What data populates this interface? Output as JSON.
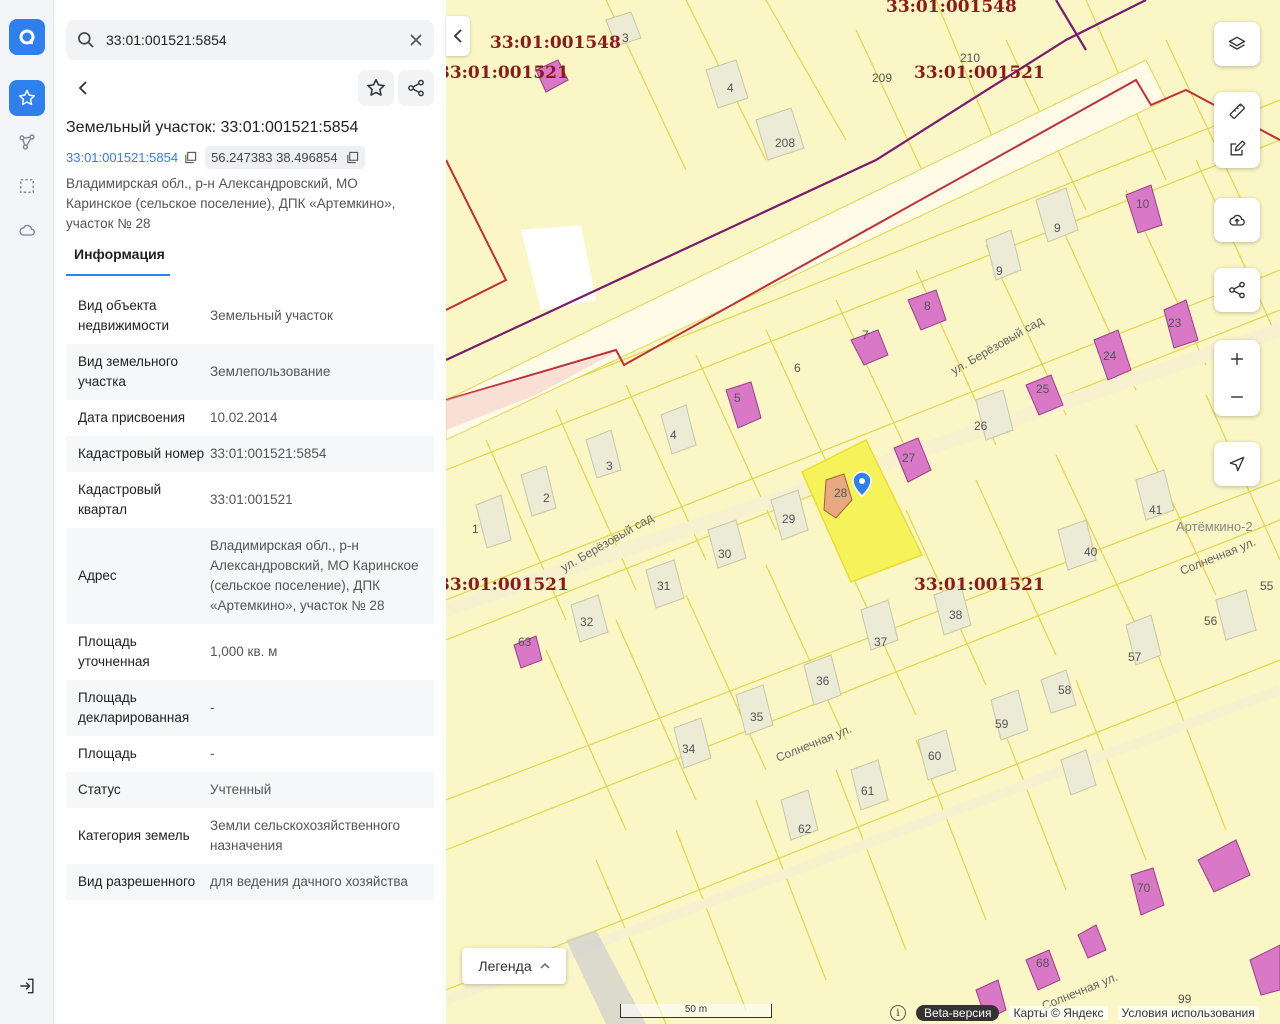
{
  "search": {
    "value": "33:01:001521:5854"
  },
  "object": {
    "title": "Земельный участок: 33:01:001521:5854",
    "cad_link": "33:01:001521:5854",
    "coords": "56.247383 38.496854",
    "address": "Владимирская обл., р-н Александровский, МО Каринское (сельское поселение), ДПК «Артемкино», участок № 28"
  },
  "tabs": {
    "info": "Информация"
  },
  "info_rows": [
    {
      "k": "Вид объекта недвижимости",
      "v": "Земельный участок"
    },
    {
      "k": "Вид земельного участка",
      "v": "Землепользование"
    },
    {
      "k": "Дата присвоения",
      "v": "10.02.2014"
    },
    {
      "k": "Кадастровый номер",
      "v": "33:01:001521:5854"
    },
    {
      "k": "Кадастровый квартал",
      "v": "33:01:001521"
    },
    {
      "k": "Адрес",
      "v": "Владимирская обл., р-н Александровский, МО Каринское (сельское поселение), ДПК «Артемкино», участок № 28"
    },
    {
      "k": "Площадь уточненная",
      "v": "1,000 кв. м"
    },
    {
      "k": "Площадь декларированная",
      "v": "-"
    },
    {
      "k": "Площадь",
      "v": "-"
    },
    {
      "k": "Статус",
      "v": "Учтенный"
    },
    {
      "k": "Категория земель",
      "v": "Земли сельскохозяйственного назначения"
    },
    {
      "k": "Вид разрешенного",
      "v": "для ведения дачного хозяйства"
    }
  ],
  "map": {
    "quarter_labels": [
      "33:01:001548",
      "33:01:001548",
      "33:01:001521",
      "33:01:001521",
      "33:01:001521",
      "33:01:001521"
    ],
    "streets": [
      "ул. Берёзовый сад",
      "ул. Берёзовый сад",
      "Солнечная ул.",
      "Солнечная ул.",
      "Солнечная ул."
    ],
    "place": "Артёмкино-2",
    "plot_numbers": [
      "3",
      "4",
      "209",
      "210",
      "208",
      "10",
      "9",
      "9",
      "8",
      "7",
      "6",
      "5",
      "23",
      "24",
      "25",
      "26",
      "27",
      "28",
      "4",
      "3",
      "2",
      "1",
      "29",
      "30",
      "31",
      "32",
      "63",
      "37",
      "36",
      "35",
      "34",
      "38",
      "40",
      "41",
      "55",
      "56",
      "57",
      "58",
      "59",
      "60",
      "61",
      "62",
      "70",
      "68",
      "99"
    ],
    "legend": "Легенда",
    "scale": "50 m",
    "beta": "Beta-версия",
    "copyright": "Карты © Яндекс",
    "terms": "Условия использования"
  },
  "colors": {
    "accent": "#2f80ed",
    "plot": "#fbf6c5",
    "selected": "#f5f25a",
    "building": "#d978c7",
    "quarter_border": "#c0303a",
    "district_border": "#7a1b6e"
  },
  "icons": [
    "logo-icon",
    "star-icon",
    "route-icon",
    "select-area-icon",
    "cloud-icon",
    "logout-icon",
    "search-icon",
    "close-icon",
    "back-icon",
    "share-icon",
    "layers-icon",
    "ruler-icon",
    "edit-icon",
    "upload-icon",
    "plus-icon",
    "minus-icon",
    "locate-icon",
    "map-pin-icon"
  ]
}
